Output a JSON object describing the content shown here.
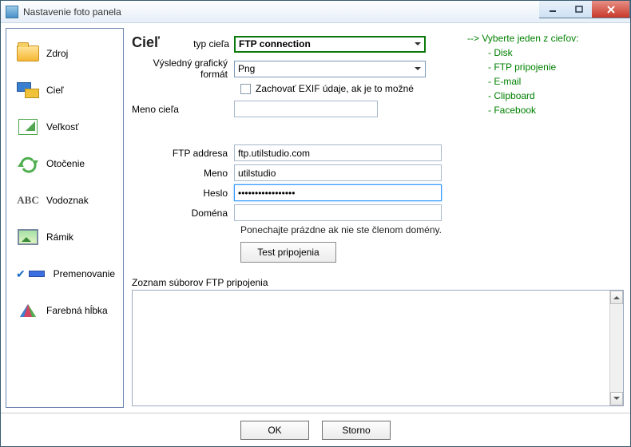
{
  "window": {
    "title": "Nastavenie foto panela"
  },
  "sidebar": {
    "items": [
      {
        "label": "Zdroj"
      },
      {
        "label": "Cieľ"
      },
      {
        "label": "Veľkosť"
      },
      {
        "label": "Otočenie"
      },
      {
        "label": "Vodoznak"
      },
      {
        "label": "Rámik"
      },
      {
        "label": "Premenovanie"
      },
      {
        "label": "Farebná hĺbka"
      }
    ]
  },
  "main": {
    "heading": "Cieľ",
    "typ_label": "typ cieľa",
    "typ_value": "FTP connection",
    "format_label": "Výsledný grafický formát",
    "format_value": "Png",
    "exif_label": "Zachovať EXIF údaje, ak je to možné",
    "meno_ciela_label": "Meno cieľa",
    "meno_ciela_value": "",
    "ftp_address_label": "FTP addresa",
    "ftp_address_value": "ftp.utilstudio.com",
    "meno_label": "Meno",
    "meno_value": "utilstudio",
    "heslo_label": "Heslo",
    "heslo_value": "•••••••••••••••••",
    "domena_label": "Doména",
    "domena_value": "",
    "domena_note": "Ponechajte prázdne ak nie ste členom domény.",
    "test_btn": "Test pripojenia",
    "list_label": "Zoznam súborov FTP pripojenia"
  },
  "hint": {
    "lead": "--> Vyberte jeden z cieľov:",
    "items": [
      "Disk",
      "FTP pripojenie",
      "E-mail",
      "Clipboard",
      "Facebook"
    ]
  },
  "footer": {
    "ok": "OK",
    "cancel": "Storno"
  }
}
